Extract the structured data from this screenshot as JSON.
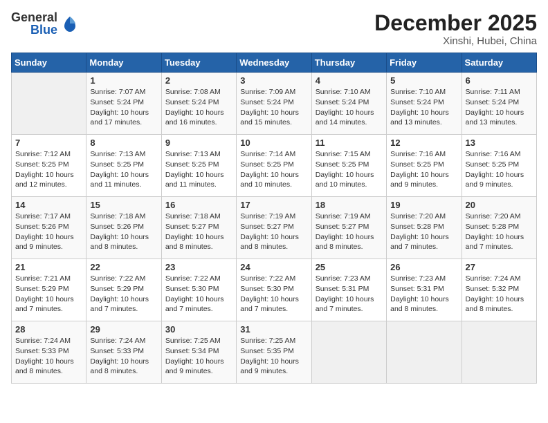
{
  "header": {
    "logo_general": "General",
    "logo_blue": "Blue",
    "month": "December 2025",
    "location": "Xinshi, Hubei, China"
  },
  "days_of_week": [
    "Sunday",
    "Monday",
    "Tuesday",
    "Wednesday",
    "Thursday",
    "Friday",
    "Saturday"
  ],
  "weeks": [
    [
      {
        "day": "",
        "info": ""
      },
      {
        "day": "1",
        "info": "Sunrise: 7:07 AM\nSunset: 5:24 PM\nDaylight: 10 hours and 17 minutes."
      },
      {
        "day": "2",
        "info": "Sunrise: 7:08 AM\nSunset: 5:24 PM\nDaylight: 10 hours and 16 minutes."
      },
      {
        "day": "3",
        "info": "Sunrise: 7:09 AM\nSunset: 5:24 PM\nDaylight: 10 hours and 15 minutes."
      },
      {
        "day": "4",
        "info": "Sunrise: 7:10 AM\nSunset: 5:24 PM\nDaylight: 10 hours and 14 minutes."
      },
      {
        "day": "5",
        "info": "Sunrise: 7:10 AM\nSunset: 5:24 PM\nDaylight: 10 hours and 13 minutes."
      },
      {
        "day": "6",
        "info": "Sunrise: 7:11 AM\nSunset: 5:24 PM\nDaylight: 10 hours and 13 minutes."
      }
    ],
    [
      {
        "day": "7",
        "info": "Sunrise: 7:12 AM\nSunset: 5:25 PM\nDaylight: 10 hours and 12 minutes."
      },
      {
        "day": "8",
        "info": "Sunrise: 7:13 AM\nSunset: 5:25 PM\nDaylight: 10 hours and 11 minutes."
      },
      {
        "day": "9",
        "info": "Sunrise: 7:13 AM\nSunset: 5:25 PM\nDaylight: 10 hours and 11 minutes."
      },
      {
        "day": "10",
        "info": "Sunrise: 7:14 AM\nSunset: 5:25 PM\nDaylight: 10 hours and 10 minutes."
      },
      {
        "day": "11",
        "info": "Sunrise: 7:15 AM\nSunset: 5:25 PM\nDaylight: 10 hours and 10 minutes."
      },
      {
        "day": "12",
        "info": "Sunrise: 7:16 AM\nSunset: 5:25 PM\nDaylight: 10 hours and 9 minutes."
      },
      {
        "day": "13",
        "info": "Sunrise: 7:16 AM\nSunset: 5:25 PM\nDaylight: 10 hours and 9 minutes."
      }
    ],
    [
      {
        "day": "14",
        "info": "Sunrise: 7:17 AM\nSunset: 5:26 PM\nDaylight: 10 hours and 9 minutes."
      },
      {
        "day": "15",
        "info": "Sunrise: 7:18 AM\nSunset: 5:26 PM\nDaylight: 10 hours and 8 minutes."
      },
      {
        "day": "16",
        "info": "Sunrise: 7:18 AM\nSunset: 5:27 PM\nDaylight: 10 hours and 8 minutes."
      },
      {
        "day": "17",
        "info": "Sunrise: 7:19 AM\nSunset: 5:27 PM\nDaylight: 10 hours and 8 minutes."
      },
      {
        "day": "18",
        "info": "Sunrise: 7:19 AM\nSunset: 5:27 PM\nDaylight: 10 hours and 8 minutes."
      },
      {
        "day": "19",
        "info": "Sunrise: 7:20 AM\nSunset: 5:28 PM\nDaylight: 10 hours and 7 minutes."
      },
      {
        "day": "20",
        "info": "Sunrise: 7:20 AM\nSunset: 5:28 PM\nDaylight: 10 hours and 7 minutes."
      }
    ],
    [
      {
        "day": "21",
        "info": "Sunrise: 7:21 AM\nSunset: 5:29 PM\nDaylight: 10 hours and 7 minutes."
      },
      {
        "day": "22",
        "info": "Sunrise: 7:22 AM\nSunset: 5:29 PM\nDaylight: 10 hours and 7 minutes."
      },
      {
        "day": "23",
        "info": "Sunrise: 7:22 AM\nSunset: 5:30 PM\nDaylight: 10 hours and 7 minutes."
      },
      {
        "day": "24",
        "info": "Sunrise: 7:22 AM\nSunset: 5:30 PM\nDaylight: 10 hours and 7 minutes."
      },
      {
        "day": "25",
        "info": "Sunrise: 7:23 AM\nSunset: 5:31 PM\nDaylight: 10 hours and 7 minutes."
      },
      {
        "day": "26",
        "info": "Sunrise: 7:23 AM\nSunset: 5:31 PM\nDaylight: 10 hours and 8 minutes."
      },
      {
        "day": "27",
        "info": "Sunrise: 7:24 AM\nSunset: 5:32 PM\nDaylight: 10 hours and 8 minutes."
      }
    ],
    [
      {
        "day": "28",
        "info": "Sunrise: 7:24 AM\nSunset: 5:33 PM\nDaylight: 10 hours and 8 minutes."
      },
      {
        "day": "29",
        "info": "Sunrise: 7:24 AM\nSunset: 5:33 PM\nDaylight: 10 hours and 8 minutes."
      },
      {
        "day": "30",
        "info": "Sunrise: 7:25 AM\nSunset: 5:34 PM\nDaylight: 10 hours and 9 minutes."
      },
      {
        "day": "31",
        "info": "Sunrise: 7:25 AM\nSunset: 5:35 PM\nDaylight: 10 hours and 9 minutes."
      },
      {
        "day": "",
        "info": ""
      },
      {
        "day": "",
        "info": ""
      },
      {
        "day": "",
        "info": ""
      }
    ]
  ]
}
